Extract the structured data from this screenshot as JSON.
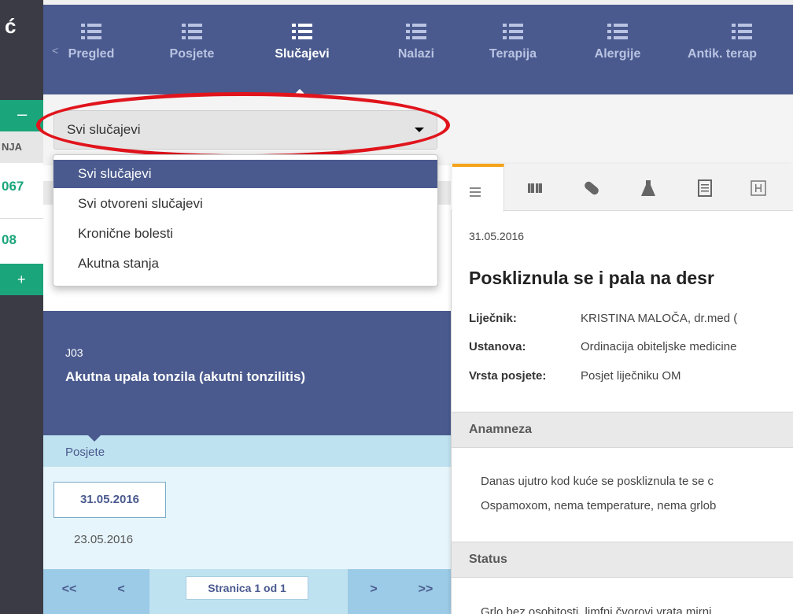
{
  "app": {
    "left_letter": "ć"
  },
  "left_strip": {
    "minus": "–",
    "header": "NJA",
    "number1": "067",
    "number2": "08",
    "plus": "+"
  },
  "nav": {
    "back": "<",
    "items": [
      {
        "label": "Pregled",
        "icon": "list-icon"
      },
      {
        "label": "Posjete",
        "icon": "list-icon"
      },
      {
        "label": "Slučajevi",
        "icon": "list-icon",
        "active": true
      },
      {
        "label": "Nalazi",
        "icon": "list-icon"
      },
      {
        "label": "Terapija",
        "icon": "list-icon"
      },
      {
        "label": "Alergije",
        "icon": "list-icon"
      },
      {
        "label": "Antik. terap",
        "icon": "list-icon"
      }
    ]
  },
  "filter": {
    "selected": "Svi slučajevi",
    "options": [
      "Svi slučajevi",
      "Svi otvoreni slučajevi",
      "Kronične bolesti",
      "Akutna stanja"
    ]
  },
  "case": {
    "code": "J03",
    "title": "Akutna upala tonzila (akutni tonzilitis)",
    "visits_label": "Posjete",
    "visits": [
      "31.05.2016",
      "23.05.2016"
    ],
    "pager": {
      "first": "<<",
      "prev": "<",
      "page": "Stranica 1 od 1",
      "next": ">",
      "last": ">>"
    }
  },
  "detail": {
    "tabs": [
      "list-icon",
      "book-icon",
      "pill-icon",
      "flask-icon",
      "document-icon",
      "h-icon"
    ],
    "date": "31.05.2016",
    "title": "Poskliznula se i pala na desr",
    "doctor_label": "Liječnik:",
    "doctor": "KRISTINA MALOČA, dr.med (",
    "institution_label": "Ustanova:",
    "institution": "Ordinacija obiteljske medicine",
    "visit_type_label": "Vrsta posjete:",
    "visit_type": "Posjet liječniku OM",
    "anamnesis_title": "Anamneza",
    "anamnesis_line1": "Danas ujutro kod kuće se poskliznula te se c",
    "anamnesis_line2": "Ospamoxom, nema temperature, nema grlob",
    "status_title": "Status",
    "status_line1": "Grlo bez osobitosti, limfni čvorovi vrata mirni"
  },
  "colors": {
    "nav": "#4a5a8e",
    "green": "#1aa57a",
    "highlight": "#e1141c",
    "tab_accent": "#f5a31b"
  }
}
